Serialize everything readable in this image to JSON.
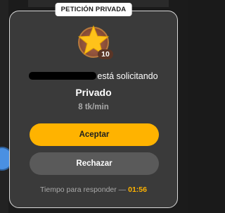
{
  "modal": {
    "tag": "PETICIÓN PRIVADA",
    "user_level": "10",
    "request_text": "está solicitando",
    "mode": "Privado",
    "rate": "8 tk/min",
    "accept_label": "Aceptar",
    "reject_label": "Rechazar",
    "timer_label": "Tiempo para responder —",
    "timer_value": "01:56"
  },
  "icons": {
    "avatar": "star-avatar-icon"
  },
  "colors": {
    "accent": "#ffb300",
    "modal_bg": "#3a3a3a",
    "reject_bg": "#5a5a5a"
  }
}
